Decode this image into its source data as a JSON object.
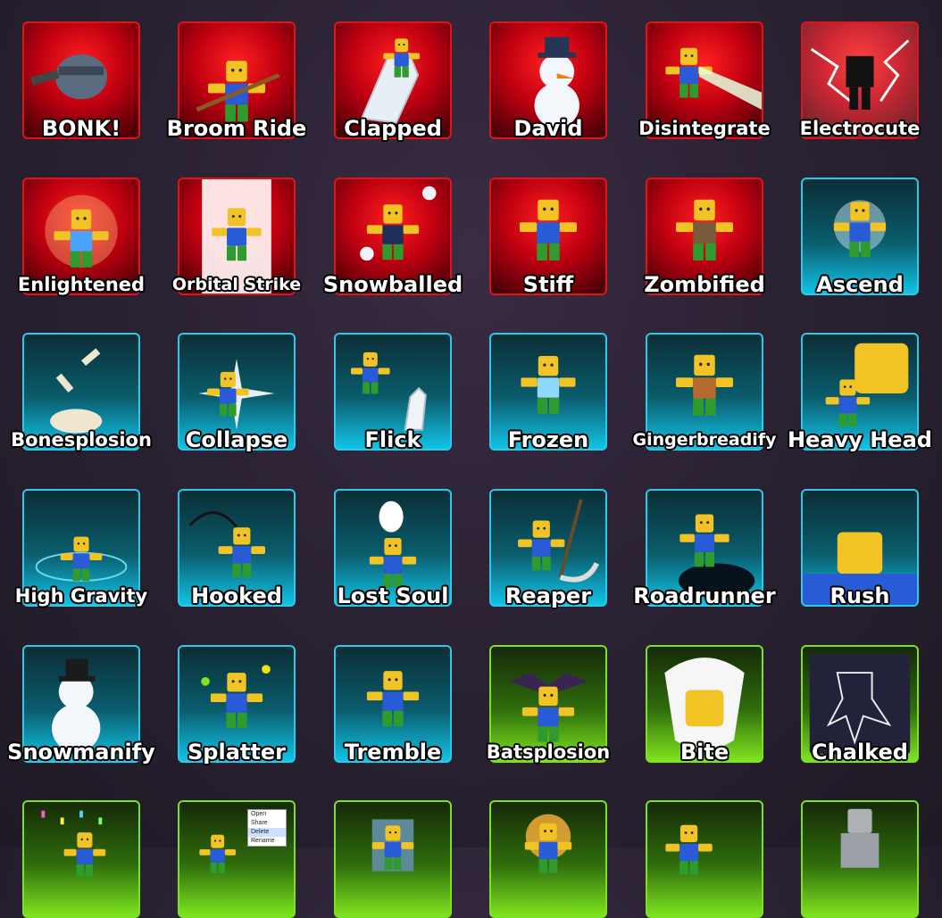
{
  "emotes": [
    {
      "label": "BONK!",
      "theme": "red",
      "icon": "bonk-pot-icon"
    },
    {
      "label": "Broom Ride",
      "theme": "red",
      "icon": "broom-ride-icon"
    },
    {
      "label": "Clapped",
      "theme": "red",
      "icon": "clapping-hands-icon"
    },
    {
      "label": "David",
      "theme": "red",
      "icon": "snowman-icon"
    },
    {
      "label": "Disintegrate",
      "theme": "red",
      "icon": "disintegrate-beam-icon"
    },
    {
      "label": "Electrocute",
      "theme": "red",
      "icon": "electrocute-skeleton-icon"
    },
    {
      "label": "Enlightened",
      "theme": "red",
      "icon": "enlightened-icon"
    },
    {
      "label": "Orbital Strike",
      "theme": "red",
      "icon": "orbital-strike-icon"
    },
    {
      "label": "Snowballed",
      "theme": "red",
      "icon": "snowball-icon"
    },
    {
      "label": "Stiff",
      "theme": "red",
      "icon": "stiff-character-icon"
    },
    {
      "label": "Zombified",
      "theme": "red",
      "icon": "zombie-icon"
    },
    {
      "label": "Ascend",
      "theme": "cyan",
      "icon": "ascend-glow-icon"
    },
    {
      "label": "Bonesplosion",
      "theme": "cyan",
      "icon": "bones-icon"
    },
    {
      "label": "Collapse",
      "theme": "cyan",
      "icon": "collapse-flash-icon"
    },
    {
      "label": "Flick",
      "theme": "cyan",
      "icon": "flick-hand-icon"
    },
    {
      "label": "Frozen",
      "theme": "cyan",
      "icon": "frozen-character-icon"
    },
    {
      "label": "Gingerbreadify",
      "theme": "cyan",
      "icon": "gingerbread-icon"
    },
    {
      "label": "Heavy Head",
      "theme": "cyan",
      "icon": "heavy-head-icon"
    },
    {
      "label": "High Gravity",
      "theme": "cyan",
      "icon": "high-gravity-icon"
    },
    {
      "label": "Hooked",
      "theme": "cyan",
      "icon": "hook-icon"
    },
    {
      "label": "Lost Soul",
      "theme": "cyan",
      "icon": "ghost-icon"
    },
    {
      "label": "Reaper",
      "theme": "cyan",
      "icon": "scythe-icon"
    },
    {
      "label": "Roadrunner",
      "theme": "cyan",
      "icon": "roadrunner-hole-icon"
    },
    {
      "label": "Rush",
      "theme": "cyan",
      "icon": "rush-face-icon"
    },
    {
      "label": "Snowmanify",
      "theme": "cyan",
      "icon": "snowman-hat-icon"
    },
    {
      "label": "Splatter",
      "theme": "cyan",
      "icon": "paint-splatter-icon"
    },
    {
      "label": "Tremble",
      "theme": "cyan",
      "icon": "tremble-character-icon"
    },
    {
      "label": "Batsplosion",
      "theme": "green",
      "icon": "bats-icon"
    },
    {
      "label": "Bite",
      "theme": "green",
      "icon": "bite-teeth-icon"
    },
    {
      "label": "Chalked",
      "theme": "green",
      "icon": "chalk-outline-icon"
    },
    {
      "label": "",
      "theme": "green",
      "icon": "confetti-icon"
    },
    {
      "label": "",
      "theme": "green",
      "icon": "context-menu-icon"
    },
    {
      "label": "",
      "theme": "green",
      "icon": "character-box-icon"
    },
    {
      "label": "",
      "theme": "green",
      "icon": "explosion-icon"
    },
    {
      "label": "",
      "theme": "green",
      "icon": "dizzy-character-icon"
    },
    {
      "label": "",
      "theme": "green",
      "icon": "stone-statue-icon"
    }
  ],
  "context_menu": {
    "items": [
      "Open",
      "Share",
      "Delete",
      "Rename"
    ],
    "highlighted_index": 2
  },
  "colors": {
    "red_border": "#e0141b",
    "cyan_border": "#2fc9e8",
    "green_border": "#7ee021",
    "background": "#2b2233"
  }
}
